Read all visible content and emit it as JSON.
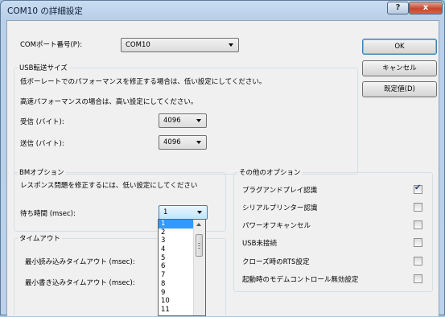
{
  "window": {
    "title": "COM10 の詳細設定",
    "help_glyph": "?",
    "close_glyph": "x"
  },
  "port": {
    "label": "COMポート番号(P):",
    "value": "COM10"
  },
  "buttons": {
    "ok": "OK",
    "cancel": "キャンセル",
    "defaults": "既定値(D)"
  },
  "usb": {
    "caption": "USB転送サイズ",
    "desc1": "低ボーレートでのパフォーマンスを修正する場合は、低い設定にしてください。",
    "desc2": "高速パフォーマンスの場合は、高い設定にしてください。",
    "receive_label": "受信 (バイト):",
    "receive_value": "4096",
    "send_label": "送信 (バイト):",
    "send_value": "4096"
  },
  "bm": {
    "caption": "BMオプション",
    "desc": "レスポンス問題を修正するには、低い設定にしてください",
    "latency_label": "待ち時間 (msec):",
    "latency_value": "1",
    "latency_options": [
      "1",
      "2",
      "3",
      "4",
      "5",
      "6",
      "7",
      "8",
      "9",
      "10",
      "11"
    ]
  },
  "timeout": {
    "caption": "タイムアウト",
    "read_label": "最小読み込みタイムアウト (msec):",
    "write_label": "最小書き込みタイムアウト (msec):"
  },
  "other": {
    "caption": "その他のオプション",
    "options": [
      {
        "label": "プラグアンドプレイ認識",
        "checked": true
      },
      {
        "label": "シリアルプリンター認識",
        "checked": false
      },
      {
        "label": "パワーオフキャンセル",
        "checked": false
      },
      {
        "label": "USB未接続",
        "checked": false
      },
      {
        "label": "クローズ時のRTS設定",
        "checked": false
      },
      {
        "label": "起動時のモデムコントロール無効設定",
        "checked": false
      }
    ],
    "check_glyph": "✔"
  }
}
